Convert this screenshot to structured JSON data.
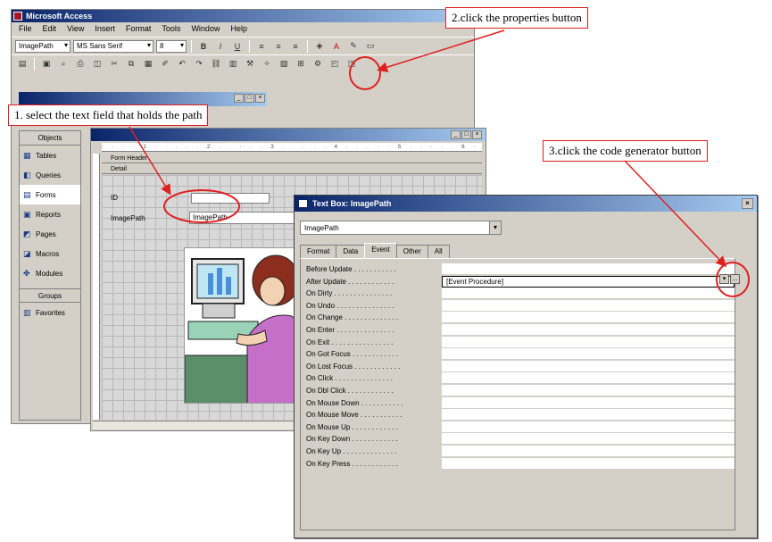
{
  "access_window": {
    "title": "Microsoft Access",
    "menu": [
      "File",
      "Edit",
      "View",
      "Insert",
      "Format",
      "Tools",
      "Window",
      "Help"
    ],
    "object_combo": "ImagePath",
    "font_combo": "MS Sans Serif",
    "size_combo": "8"
  },
  "database_window": {
    "objects_header": "Objects",
    "items": [
      "Tables",
      "Queries",
      "Forms",
      "Reports",
      "Pages",
      "Macros",
      "Modules"
    ],
    "groups_header": "Groups",
    "favorites": "Favorites"
  },
  "form_design": {
    "form_header_label": "Form Header",
    "detail_label": "Detail",
    "id_label": "ID",
    "imagepath_label": "ImagePath",
    "imagepath_textbox": "ImagePath"
  },
  "properties": {
    "title": "Text Box: ImagePath",
    "selector_value": "ImagePath",
    "tabs": [
      "Format",
      "Data",
      "Event",
      "Other",
      "All"
    ],
    "active_tab": "Event",
    "rows": [
      {
        "label": "Before Update . . . . . . . . . . .",
        "value": ""
      },
      {
        "label": "After Update . . . . . . . . . . . .",
        "value": "[Event Procedure]"
      },
      {
        "label": "On Dirty . . . . . . . . . . . . . . .",
        "value": ""
      },
      {
        "label": "On Undo . . . . . . . . . . . . . . .",
        "value": ""
      },
      {
        "label": "On Change . . . . . . . . . . . . . .",
        "value": ""
      },
      {
        "label": "On Enter . . . . . . . . . . . . . . .",
        "value": ""
      },
      {
        "label": "On Exit . . . . . . . . . . . . . . . .",
        "value": ""
      },
      {
        "label": "On Got Focus . . . . . . . . . . . .",
        "value": ""
      },
      {
        "label": "On Lost Focus . . . . . . . . . . . .",
        "value": ""
      },
      {
        "label": "On Click . . . . . . . . . . . . . . .",
        "value": ""
      },
      {
        "label": "On Dbl Click . . . . . . . . . . . .",
        "value": ""
      },
      {
        "label": "On Mouse Down . . . . . . . . . . .",
        "value": ""
      },
      {
        "label": "On Mouse Move . . . . . . . . . . .",
        "value": ""
      },
      {
        "label": "On Mouse Up . . . . . . . . . . . .",
        "value": ""
      },
      {
        "label": "On Key Down . . . . . . . . . . . .",
        "value": ""
      },
      {
        "label": "On Key Up . . . . . . . . . . . . . .",
        "value": ""
      },
      {
        "label": "On Key Press . . . . . . . . . . . .",
        "value": ""
      }
    ]
  },
  "callouts": {
    "step1": "1. select the text field that holds the path",
    "step2": "2.click the properties button",
    "step3": "3.click the code generator button"
  },
  "colors": {
    "callout_red": "#e02020",
    "title_blue": "#0a246a",
    "chrome_gray": "#d4d0c8"
  }
}
